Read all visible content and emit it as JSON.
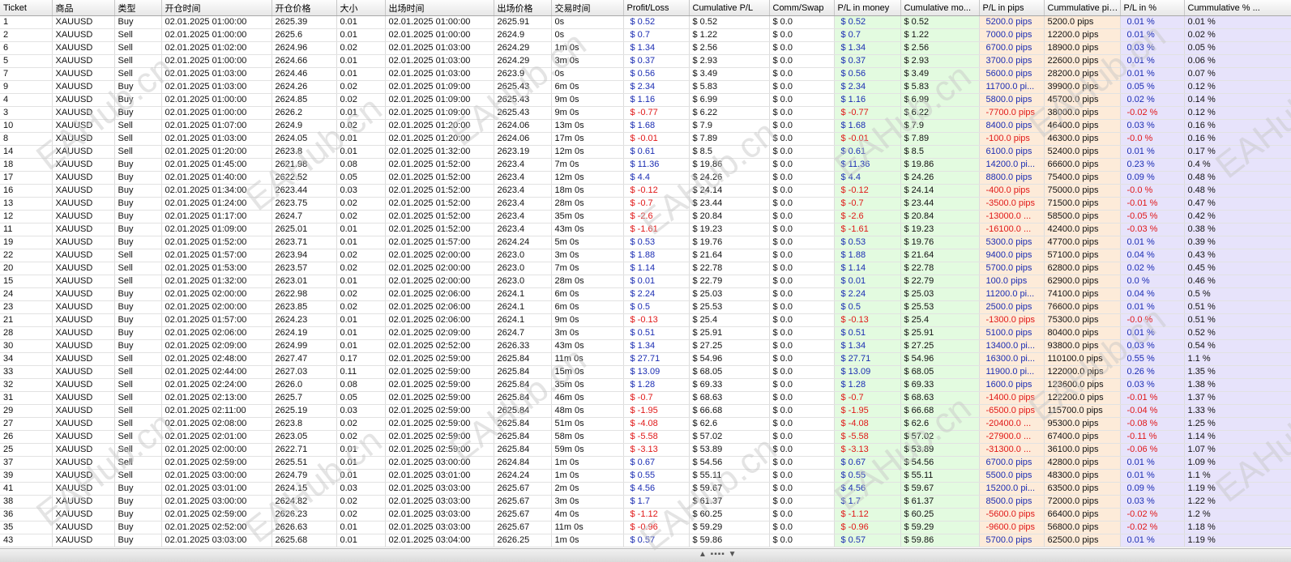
{
  "columns": [
    {
      "key": "ticket",
      "label": "Ticket"
    },
    {
      "key": "symbol",
      "label": "商品"
    },
    {
      "key": "type",
      "label": "类型"
    },
    {
      "key": "open_time",
      "label": "开仓时间"
    },
    {
      "key": "open_price",
      "label": "开仓价格"
    },
    {
      "key": "size",
      "label": "大小"
    },
    {
      "key": "close_time",
      "label": "出场时间"
    },
    {
      "key": "close_price",
      "label": "出场价格"
    },
    {
      "key": "duration",
      "label": "交易时间"
    },
    {
      "key": "pl",
      "label": "Profit/Loss"
    },
    {
      "key": "cum_pl",
      "label": "Cumulative P/L"
    },
    {
      "key": "comm",
      "label": "Comm/Swap"
    },
    {
      "key": "pl_money",
      "label": "P/L in money"
    },
    {
      "key": "cum_money",
      "label": "Cumulative mo..."
    },
    {
      "key": "pl_pips",
      "label": "P/L in pips"
    },
    {
      "key": "cum_pips",
      "label": "Cummulative pip..."
    },
    {
      "key": "pl_pct",
      "label": "P/L in %"
    },
    {
      "key": "cum_pct",
      "label": "Cummulative % ..."
    }
  ],
  "rows": [
    [
      "1",
      "XAUUSD",
      "Buy",
      "02.01.2025 01:00:00",
      "2625.39",
      "0.01",
      "02.01.2025 01:00:00",
      "2625.91",
      "0s",
      "$ 0.52",
      "$ 0.52",
      "$ 0.0",
      "$ 0.52",
      "$ 0.52",
      "5200.0 pips",
      "5200.0 pips",
      "0.01 %",
      "0.01 %"
    ],
    [
      "2",
      "XAUUSD",
      "Sell",
      "02.01.2025 01:00:00",
      "2625.6",
      "0.01",
      "02.01.2025 01:00:00",
      "2624.9",
      "0s",
      "$ 0.7",
      "$ 1.22",
      "$ 0.0",
      "$ 0.7",
      "$ 1.22",
      "7000.0 pips",
      "12200.0 pips",
      "0.01 %",
      "0.02 %"
    ],
    [
      "6",
      "XAUUSD",
      "Sell",
      "02.01.2025 01:02:00",
      "2624.96",
      "0.02",
      "02.01.2025 01:03:00",
      "2624.29",
      "1m 0s",
      "$ 1.34",
      "$ 2.56",
      "$ 0.0",
      "$ 1.34",
      "$ 2.56",
      "6700.0 pips",
      "18900.0 pips",
      "0.03 %",
      "0.05 %"
    ],
    [
      "5",
      "XAUUSD",
      "Sell",
      "02.01.2025 01:00:00",
      "2624.66",
      "0.01",
      "02.01.2025 01:03:00",
      "2624.29",
      "3m 0s",
      "$ 0.37",
      "$ 2.93",
      "$ 0.0",
      "$ 0.37",
      "$ 2.93",
      "3700.0 pips",
      "22600.0 pips",
      "0.01 %",
      "0.06 %"
    ],
    [
      "7",
      "XAUUSD",
      "Sell",
      "02.01.2025 01:03:00",
      "2624.46",
      "0.01",
      "02.01.2025 01:03:00",
      "2623.9",
      "0s",
      "$ 0.56",
      "$ 3.49",
      "$ 0.0",
      "$ 0.56",
      "$ 3.49",
      "5600.0 pips",
      "28200.0 pips",
      "0.01 %",
      "0.07 %"
    ],
    [
      "9",
      "XAUUSD",
      "Buy",
      "02.01.2025 01:03:00",
      "2624.26",
      "0.02",
      "02.01.2025 01:09:00",
      "2625.43",
      "6m 0s",
      "$ 2.34",
      "$ 5.83",
      "$ 0.0",
      "$ 2.34",
      "$ 5.83",
      "11700.0 pi...",
      "39900.0 pips",
      "0.05 %",
      "0.12 %"
    ],
    [
      "4",
      "XAUUSD",
      "Buy",
      "02.01.2025 01:00:00",
      "2624.85",
      "0.02",
      "02.01.2025 01:09:00",
      "2625.43",
      "9m 0s",
      "$ 1.16",
      "$ 6.99",
      "$ 0.0",
      "$ 1.16",
      "$ 6.99",
      "5800.0 pips",
      "45700.0 pips",
      "0.02 %",
      "0.14 %"
    ],
    [
      "3",
      "XAUUSD",
      "Buy",
      "02.01.2025 01:00:00",
      "2626.2",
      "0.01",
      "02.01.2025 01:09:00",
      "2625.43",
      "9m 0s",
      "$ -0.77",
      "$ 6.22",
      "$ 0.0",
      "$ -0.77",
      "$ 6.22",
      "-7700.0 pips",
      "38000.0 pips",
      "-0.02 %",
      "0.12 %"
    ],
    [
      "10",
      "XAUUSD",
      "Sell",
      "02.01.2025 01:07:00",
      "2624.9",
      "0.02",
      "02.01.2025 01:20:00",
      "2624.06",
      "13m 0s",
      "$ 1.68",
      "$ 7.9",
      "$ 0.0",
      "$ 1.68",
      "$ 7.9",
      "8400.0 pips",
      "46400.0 pips",
      "0.03 %",
      "0.16 %"
    ],
    [
      "8",
      "XAUUSD",
      "Sell",
      "02.01.2025 01:03:00",
      "2624.05",
      "0.01",
      "02.01.2025 01:20:00",
      "2624.06",
      "17m 0s",
      "$ -0.01",
      "$ 7.89",
      "$ 0.0",
      "$ -0.01",
      "$ 7.89",
      "-100.0 pips",
      "46300.0 pips",
      "-0.0 %",
      "0.16 %"
    ],
    [
      "14",
      "XAUUSD",
      "Sell",
      "02.01.2025 01:20:00",
      "2623.8",
      "0.01",
      "02.01.2025 01:32:00",
      "2623.19",
      "12m 0s",
      "$ 0.61",
      "$ 8.5",
      "$ 0.0",
      "$ 0.61",
      "$ 8.5",
      "6100.0 pips",
      "52400.0 pips",
      "0.01 %",
      "0.17 %"
    ],
    [
      "18",
      "XAUUSD",
      "Buy",
      "02.01.2025 01:45:00",
      "2621.98",
      "0.08",
      "02.01.2025 01:52:00",
      "2623.4",
      "7m 0s",
      "$ 11.36",
      "$ 19.86",
      "$ 0.0",
      "$ 11.36",
      "$ 19.86",
      "14200.0 pi...",
      "66600.0 pips",
      "0.23 %",
      "0.4 %"
    ],
    [
      "17",
      "XAUUSD",
      "Buy",
      "02.01.2025 01:40:00",
      "2622.52",
      "0.05",
      "02.01.2025 01:52:00",
      "2623.4",
      "12m 0s",
      "$ 4.4",
      "$ 24.26",
      "$ 0.0",
      "$ 4.4",
      "$ 24.26",
      "8800.0 pips",
      "75400.0 pips",
      "0.09 %",
      "0.48 %"
    ],
    [
      "16",
      "XAUUSD",
      "Buy",
      "02.01.2025 01:34:00",
      "2623.44",
      "0.03",
      "02.01.2025 01:52:00",
      "2623.4",
      "18m 0s",
      "$ -0.12",
      "$ 24.14",
      "$ 0.0",
      "$ -0.12",
      "$ 24.14",
      "-400.0 pips",
      "75000.0 pips",
      "-0.0 %",
      "0.48 %"
    ],
    [
      "13",
      "XAUUSD",
      "Buy",
      "02.01.2025 01:24:00",
      "2623.75",
      "0.02",
      "02.01.2025 01:52:00",
      "2623.4",
      "28m 0s",
      "$ -0.7",
      "$ 23.44",
      "$ 0.0",
      "$ -0.7",
      "$ 23.44",
      "-3500.0 pips",
      "71500.0 pips",
      "-0.01 %",
      "0.47 %"
    ],
    [
      "12",
      "XAUUSD",
      "Buy",
      "02.01.2025 01:17:00",
      "2624.7",
      "0.02",
      "02.01.2025 01:52:00",
      "2623.4",
      "35m 0s",
      "$ -2.6",
      "$ 20.84",
      "$ 0.0",
      "$ -2.6",
      "$ 20.84",
      "-13000.0 ...",
      "58500.0 pips",
      "-0.05 %",
      "0.42 %"
    ],
    [
      "11",
      "XAUUSD",
      "Buy",
      "02.01.2025 01:09:00",
      "2625.01",
      "0.01",
      "02.01.2025 01:52:00",
      "2623.4",
      "43m 0s",
      "$ -1.61",
      "$ 19.23",
      "$ 0.0",
      "$ -1.61",
      "$ 19.23",
      "-16100.0 ...",
      "42400.0 pips",
      "-0.03 %",
      "0.38 %"
    ],
    [
      "19",
      "XAUUSD",
      "Buy",
      "02.01.2025 01:52:00",
      "2623.71",
      "0.01",
      "02.01.2025 01:57:00",
      "2624.24",
      "5m 0s",
      "$ 0.53",
      "$ 19.76",
      "$ 0.0",
      "$ 0.53",
      "$ 19.76",
      "5300.0 pips",
      "47700.0 pips",
      "0.01 %",
      "0.39 %"
    ],
    [
      "22",
      "XAUUSD",
      "Sell",
      "02.01.2025 01:57:00",
      "2623.94",
      "0.02",
      "02.01.2025 02:00:00",
      "2623.0",
      "3m 0s",
      "$ 1.88",
      "$ 21.64",
      "$ 0.0",
      "$ 1.88",
      "$ 21.64",
      "9400.0 pips",
      "57100.0 pips",
      "0.04 %",
      "0.43 %"
    ],
    [
      "20",
      "XAUUSD",
      "Sell",
      "02.01.2025 01:53:00",
      "2623.57",
      "0.02",
      "02.01.2025 02:00:00",
      "2623.0",
      "7m 0s",
      "$ 1.14",
      "$ 22.78",
      "$ 0.0",
      "$ 1.14",
      "$ 22.78",
      "5700.0 pips",
      "62800.0 pips",
      "0.02 %",
      "0.45 %"
    ],
    [
      "15",
      "XAUUSD",
      "Sell",
      "02.01.2025 01:32:00",
      "2623.01",
      "0.01",
      "02.01.2025 02:00:00",
      "2623.0",
      "28m 0s",
      "$ 0.01",
      "$ 22.79",
      "$ 0.0",
      "$ 0.01",
      "$ 22.79",
      "100.0 pips",
      "62900.0 pips",
      "0.0 %",
      "0.46 %"
    ],
    [
      "24",
      "XAUUSD",
      "Buy",
      "02.01.2025 02:00:00",
      "2622.98",
      "0.02",
      "02.01.2025 02:06:00",
      "2624.1",
      "6m 0s",
      "$ 2.24",
      "$ 25.03",
      "$ 0.0",
      "$ 2.24",
      "$ 25.03",
      "11200.0 pi...",
      "74100.0 pips",
      "0.04 %",
      "0.5 %"
    ],
    [
      "23",
      "XAUUSD",
      "Buy",
      "02.01.2025 02:00:00",
      "2623.85",
      "0.02",
      "02.01.2025 02:06:00",
      "2624.1",
      "6m 0s",
      "$ 0.5",
      "$ 25.53",
      "$ 0.0",
      "$ 0.5",
      "$ 25.53",
      "2500.0 pips",
      "76600.0 pips",
      "0.01 %",
      "0.51 %"
    ],
    [
      "21",
      "XAUUSD",
      "Buy",
      "02.01.2025 01:57:00",
      "2624.23",
      "0.01",
      "02.01.2025 02:06:00",
      "2624.1",
      "9m 0s",
      "$ -0.13",
      "$ 25.4",
      "$ 0.0",
      "$ -0.13",
      "$ 25.4",
      "-1300.0 pips",
      "75300.0 pips",
      "-0.0 %",
      "0.51 %"
    ],
    [
      "28",
      "XAUUSD",
      "Buy",
      "02.01.2025 02:06:00",
      "2624.19",
      "0.01",
      "02.01.2025 02:09:00",
      "2624.7",
      "3m 0s",
      "$ 0.51",
      "$ 25.91",
      "$ 0.0",
      "$ 0.51",
      "$ 25.91",
      "5100.0 pips",
      "80400.0 pips",
      "0.01 %",
      "0.52 %"
    ],
    [
      "30",
      "XAUUSD",
      "Buy",
      "02.01.2025 02:09:00",
      "2624.99",
      "0.01",
      "02.01.2025 02:52:00",
      "2626.33",
      "43m 0s",
      "$ 1.34",
      "$ 27.25",
      "$ 0.0",
      "$ 1.34",
      "$ 27.25",
      "13400.0 pi...",
      "93800.0 pips",
      "0.03 %",
      "0.54 %"
    ],
    [
      "34",
      "XAUUSD",
      "Sell",
      "02.01.2025 02:48:00",
      "2627.47",
      "0.17",
      "02.01.2025 02:59:00",
      "2625.84",
      "11m 0s",
      "$ 27.71",
      "$ 54.96",
      "$ 0.0",
      "$ 27.71",
      "$ 54.96",
      "16300.0 pi...",
      "110100.0 pips",
      "0.55 %",
      "1.1 %"
    ],
    [
      "33",
      "XAUUSD",
      "Sell",
      "02.01.2025 02:44:00",
      "2627.03",
      "0.11",
      "02.01.2025 02:59:00",
      "2625.84",
      "15m 0s",
      "$ 13.09",
      "$ 68.05",
      "$ 0.0",
      "$ 13.09",
      "$ 68.05",
      "11900.0 pi...",
      "122000.0 pips",
      "0.26 %",
      "1.35 %"
    ],
    [
      "32",
      "XAUUSD",
      "Sell",
      "02.01.2025 02:24:00",
      "2626.0",
      "0.08",
      "02.01.2025 02:59:00",
      "2625.84",
      "35m 0s",
      "$ 1.28",
      "$ 69.33",
      "$ 0.0",
      "$ 1.28",
      "$ 69.33",
      "1600.0 pips",
      "123600.0 pips",
      "0.03 %",
      "1.38 %"
    ],
    [
      "31",
      "XAUUSD",
      "Sell",
      "02.01.2025 02:13:00",
      "2625.7",
      "0.05",
      "02.01.2025 02:59:00",
      "2625.84",
      "46m 0s",
      "$ -0.7",
      "$ 68.63",
      "$ 0.0",
      "$ -0.7",
      "$ 68.63",
      "-1400.0 pips",
      "122200.0 pips",
      "-0.01 %",
      "1.37 %"
    ],
    [
      "29",
      "XAUUSD",
      "Sell",
      "02.01.2025 02:11:00",
      "2625.19",
      "0.03",
      "02.01.2025 02:59:00",
      "2625.84",
      "48m 0s",
      "$ -1.95",
      "$ 66.68",
      "$ 0.0",
      "$ -1.95",
      "$ 66.68",
      "-6500.0 pips",
      "115700.0 pips",
      "-0.04 %",
      "1.33 %"
    ],
    [
      "27",
      "XAUUSD",
      "Sell",
      "02.01.2025 02:08:00",
      "2623.8",
      "0.02",
      "02.01.2025 02:59:00",
      "2625.84",
      "51m 0s",
      "$ -4.08",
      "$ 62.6",
      "$ 0.0",
      "$ -4.08",
      "$ 62.6",
      "-20400.0 ...",
      "95300.0 pips",
      "-0.08 %",
      "1.25 %"
    ],
    [
      "26",
      "XAUUSD",
      "Sell",
      "02.01.2025 02:01:00",
      "2623.05",
      "0.02",
      "02.01.2025 02:59:00",
      "2625.84",
      "58m 0s",
      "$ -5.58",
      "$ 57.02",
      "$ 0.0",
      "$ -5.58",
      "$ 57.02",
      "-27900.0 ...",
      "67400.0 pips",
      "-0.11 %",
      "1.14 %"
    ],
    [
      "25",
      "XAUUSD",
      "Sell",
      "02.01.2025 02:00:00",
      "2622.71",
      "0.01",
      "02.01.2025 02:59:00",
      "2625.84",
      "59m 0s",
      "$ -3.13",
      "$ 53.89",
      "$ 0.0",
      "$ -3.13",
      "$ 53.89",
      "-31300.0 ...",
      "36100.0 pips",
      "-0.06 %",
      "1.07 %"
    ],
    [
      "37",
      "XAUUSD",
      "Sell",
      "02.01.2025 02:59:00",
      "2625.51",
      "0.01",
      "02.01.2025 03:00:00",
      "2624.84",
      "1m 0s",
      "$ 0.67",
      "$ 54.56",
      "$ 0.0",
      "$ 0.67",
      "$ 54.56",
      "6700.0 pips",
      "42800.0 pips",
      "0.01 %",
      "1.09 %"
    ],
    [
      "39",
      "XAUUSD",
      "Sell",
      "02.01.2025 03:00:00",
      "2624.79",
      "0.01",
      "02.01.2025 03:01:00",
      "2624.24",
      "1m 0s",
      "$ 0.55",
      "$ 55.11",
      "$ 0.0",
      "$ 0.55",
      "$ 55.11",
      "5500.0 pips",
      "48300.0 pips",
      "0.01 %",
      "1.1 %"
    ],
    [
      "41",
      "XAUUSD",
      "Buy",
      "02.01.2025 03:01:00",
      "2624.15",
      "0.03",
      "02.01.2025 03:03:00",
      "2625.67",
      "2m 0s",
      "$ 4.56",
      "$ 59.67",
      "$ 0.0",
      "$ 4.56",
      "$ 59.67",
      "15200.0 pi...",
      "63500.0 pips",
      "0.09 %",
      "1.19 %"
    ],
    [
      "38",
      "XAUUSD",
      "Buy",
      "02.01.2025 03:00:00",
      "2624.82",
      "0.02",
      "02.01.2025 03:03:00",
      "2625.67",
      "3m 0s",
      "$ 1.7",
      "$ 61.37",
      "$ 0.0",
      "$ 1.7",
      "$ 61.37",
      "8500.0 pips",
      "72000.0 pips",
      "0.03 %",
      "1.22 %"
    ],
    [
      "36",
      "XAUUSD",
      "Buy",
      "02.01.2025 02:59:00",
      "2626.23",
      "0.02",
      "02.01.2025 03:03:00",
      "2625.67",
      "4m 0s",
      "$ -1.12",
      "$ 60.25",
      "$ 0.0",
      "$ -1.12",
      "$ 60.25",
      "-5600.0 pips",
      "66400.0 pips",
      "-0.02 %",
      "1.2 %"
    ],
    [
      "35",
      "XAUUSD",
      "Buy",
      "02.01.2025 02:52:00",
      "2626.63",
      "0.01",
      "02.01.2025 03:03:00",
      "2625.67",
      "11m 0s",
      "$ -0.96",
      "$ 59.29",
      "$ 0.0",
      "$ -0.96",
      "$ 59.29",
      "-9600.0 pips",
      "56800.0 pips",
      "-0.02 %",
      "1.18 %"
    ],
    [
      "43",
      "XAUUSD",
      "Buy",
      "02.01.2025 03:03:00",
      "2625.68",
      "0.01",
      "02.01.2025 03:04:00",
      "2626.25",
      "1m 0s",
      "$ 0.57",
      "$ 59.86",
      "$ 0.0",
      "$ 0.57",
      "$ 59.86",
      "5700.0 pips",
      "62500.0 pips",
      "0.01 %",
      "1.19 %"
    ]
  ],
  "watermark": "EAHub.cn",
  "colors": {
    "positive": "#1b2db3",
    "negative": "#e01818",
    "money_bg": "#e3fbe0",
    "pips_bg": "#fdebd9",
    "pct_bg": "#e7e3fb"
  }
}
